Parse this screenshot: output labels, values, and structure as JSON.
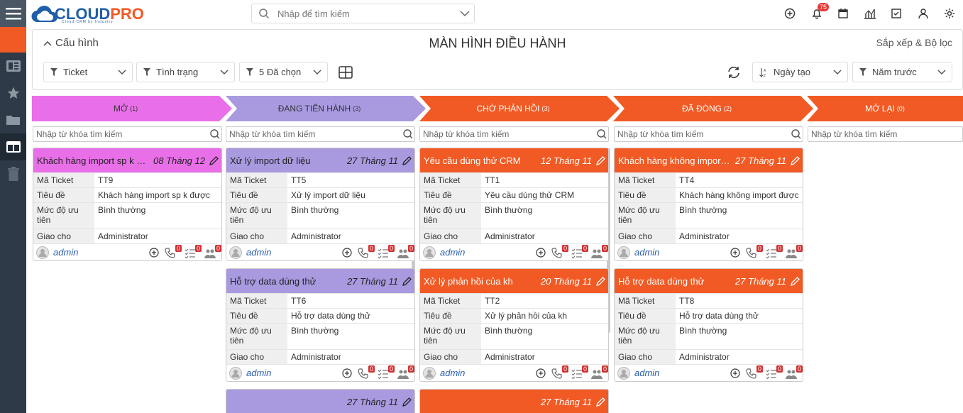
{
  "topbar": {
    "brand_a": "CLOUD",
    "brand_b": "PRO",
    "tagline": "Cloud CRM by Industry",
    "search_placeholder": "Nhập để tìm kiếm",
    "notif_count": "75"
  },
  "header": {
    "config_label": "Cấu hình",
    "title": "MÀN HÌNH ĐIỀU HÀNH",
    "sort_filter": "Sắp xếp & Bộ lọc",
    "filters": [
      "Ticket",
      "Tình trạng",
      "5 Đã chọn"
    ],
    "sort_by": "Ngày tạo",
    "period": "Năm trước"
  },
  "column_search_placeholder": "Nhập từ khóa tìm kiếm",
  "columns": [
    {
      "label": "MỞ",
      "count": "(1)",
      "color": "#e96fe8"
    },
    {
      "label": "ĐANG TIẾN HÀNH",
      "count": "(3)",
      "color": "#a99ae0"
    },
    {
      "label": "CHỜ PHẢN HỒI",
      "count": "(3)",
      "color": "#f15a24"
    },
    {
      "label": "ĐÃ ĐÓNG",
      "count": "(2)",
      "color": "#f15a24"
    },
    {
      "label": "MỞ LẠI",
      "count": "(0)",
      "color": "#f15a24"
    }
  ],
  "field_labels": {
    "code": "Mã Ticket",
    "subject": "Tiêu đề",
    "priority": "Mức độ ưu tiên",
    "assignee": "Giao cho"
  },
  "cards": [
    {
      "col": 0,
      "title": "Khách hàng import sp k được",
      "date": "08 Tháng 12",
      "code": "TT9",
      "subject": "Khách hàng import sp k được",
      "priority": "Bình thường",
      "assignee": "Administrator",
      "user": "admin"
    },
    {
      "col": 1,
      "title": "Xử lý import dữ liệu",
      "date": "27 Tháng 11",
      "code": "TT5",
      "subject": "Xử lý import dữ liệu",
      "priority": "Bình thường",
      "assignee": "Administrator",
      "user": "admin"
    },
    {
      "col": 1,
      "title": "Hỗ trợ data dùng thử",
      "date": "27 Tháng 11",
      "code": "TT6",
      "subject": "Hỗ trợ data dùng thử",
      "priority": "Bình thường",
      "assignee": "Administrator",
      "user": "admin"
    },
    {
      "col": 1,
      "title": "",
      "date": "27 Tháng 11",
      "partial": true
    },
    {
      "col": 2,
      "title": "Yêu cầu dùng thử CRM",
      "date": "12 Tháng 11",
      "code": "TT1",
      "subject": "Yêu cầu dùng thử CRM",
      "priority": "Bình thường",
      "assignee": "Administrator",
      "user": "admin"
    },
    {
      "col": 2,
      "title": "Xử lý phản hồi của kh",
      "date": "20 Tháng 11",
      "code": "TT2",
      "subject": "Xử lý phản hồi của kh",
      "priority": "Bình thường",
      "assignee": "Administrator",
      "user": "admin"
    },
    {
      "col": 2,
      "title": "",
      "date": "27 Tháng 11",
      "partial": true
    },
    {
      "col": 3,
      "title": "Khách hàng không import được",
      "date": "27 Tháng 11",
      "code": "TT4",
      "subject": "Khách hàng không import được",
      "priority": "Bình thường",
      "assignee": "Administrator",
      "user": "admin"
    },
    {
      "col": 3,
      "title": "Hỗ trợ data dùng thử",
      "date": "27 Tháng 11",
      "code": "TT8",
      "subject": "Hỗ trợ data dùng thử",
      "priority": "Bình thường",
      "assignee": "Administrator",
      "user": "admin"
    }
  ],
  "card_counts": {
    "calls": "0",
    "tasks": "0",
    "meetings": "0"
  }
}
